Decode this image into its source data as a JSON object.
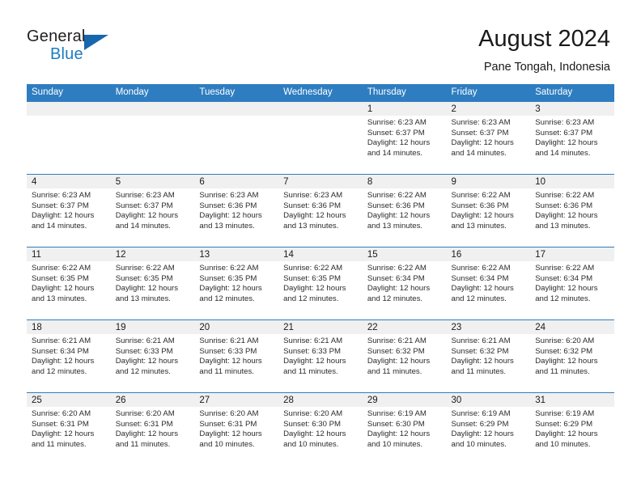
{
  "brand": {
    "word_one": "General",
    "word_two": "Blue",
    "triangle_icon": "blue-triangle-logo-mark"
  },
  "header": {
    "title": "August 2024",
    "subtitle": "Pane Tongah, Indonesia"
  },
  "colors": {
    "header_blue": "#2e7dc0",
    "brand_blue": "#1d7cc1",
    "daynum_band": "#f0f0f0",
    "text": "#1a1a1a"
  },
  "weekday_headers": [
    "Sunday",
    "Monday",
    "Tuesday",
    "Wednesday",
    "Thursday",
    "Friday",
    "Saturday"
  ],
  "labels": {
    "sunrise_prefix": "Sunrise:",
    "sunset_prefix": "Sunset:",
    "daylight_prefix": "Daylight:"
  },
  "weeks": [
    [
      {
        "day": "",
        "empty": true,
        "line1": "",
        "line2": "",
        "line3": "",
        "line4": ""
      },
      {
        "day": "",
        "empty": true,
        "line1": "",
        "line2": "",
        "line3": "",
        "line4": ""
      },
      {
        "day": "",
        "empty": true,
        "line1": "",
        "line2": "",
        "line3": "",
        "line4": ""
      },
      {
        "day": "",
        "empty": true,
        "line1": "",
        "line2": "",
        "line3": "",
        "line4": ""
      },
      {
        "day": "1",
        "line1": "Sunrise: 6:23 AM",
        "line2": "Sunset: 6:37 PM",
        "line3": "Daylight: 12 hours",
        "line4": "and 14 minutes."
      },
      {
        "day": "2",
        "line1": "Sunrise: 6:23 AM",
        "line2": "Sunset: 6:37 PM",
        "line3": "Daylight: 12 hours",
        "line4": "and 14 minutes."
      },
      {
        "day": "3",
        "line1": "Sunrise: 6:23 AM",
        "line2": "Sunset: 6:37 PM",
        "line3": "Daylight: 12 hours",
        "line4": "and 14 minutes."
      }
    ],
    [
      {
        "day": "4",
        "line1": "Sunrise: 6:23 AM",
        "line2": "Sunset: 6:37 PM",
        "line3": "Daylight: 12 hours",
        "line4": "and 14 minutes."
      },
      {
        "day": "5",
        "line1": "Sunrise: 6:23 AM",
        "line2": "Sunset: 6:37 PM",
        "line3": "Daylight: 12 hours",
        "line4": "and 14 minutes."
      },
      {
        "day": "6",
        "line1": "Sunrise: 6:23 AM",
        "line2": "Sunset: 6:36 PM",
        "line3": "Daylight: 12 hours",
        "line4": "and 13 minutes."
      },
      {
        "day": "7",
        "line1": "Sunrise: 6:23 AM",
        "line2": "Sunset: 6:36 PM",
        "line3": "Daylight: 12 hours",
        "line4": "and 13 minutes."
      },
      {
        "day": "8",
        "line1": "Sunrise: 6:22 AM",
        "line2": "Sunset: 6:36 PM",
        "line3": "Daylight: 12 hours",
        "line4": "and 13 minutes."
      },
      {
        "day": "9",
        "line1": "Sunrise: 6:22 AM",
        "line2": "Sunset: 6:36 PM",
        "line3": "Daylight: 12 hours",
        "line4": "and 13 minutes."
      },
      {
        "day": "10",
        "line1": "Sunrise: 6:22 AM",
        "line2": "Sunset: 6:36 PM",
        "line3": "Daylight: 12 hours",
        "line4": "and 13 minutes."
      }
    ],
    [
      {
        "day": "11",
        "line1": "Sunrise: 6:22 AM",
        "line2": "Sunset: 6:35 PM",
        "line3": "Daylight: 12 hours",
        "line4": "and 13 minutes."
      },
      {
        "day": "12",
        "line1": "Sunrise: 6:22 AM",
        "line2": "Sunset: 6:35 PM",
        "line3": "Daylight: 12 hours",
        "line4": "and 13 minutes."
      },
      {
        "day": "13",
        "line1": "Sunrise: 6:22 AM",
        "line2": "Sunset: 6:35 PM",
        "line3": "Daylight: 12 hours",
        "line4": "and 12 minutes."
      },
      {
        "day": "14",
        "line1": "Sunrise: 6:22 AM",
        "line2": "Sunset: 6:35 PM",
        "line3": "Daylight: 12 hours",
        "line4": "and 12 minutes."
      },
      {
        "day": "15",
        "line1": "Sunrise: 6:22 AM",
        "line2": "Sunset: 6:34 PM",
        "line3": "Daylight: 12 hours",
        "line4": "and 12 minutes."
      },
      {
        "day": "16",
        "line1": "Sunrise: 6:22 AM",
        "line2": "Sunset: 6:34 PM",
        "line3": "Daylight: 12 hours",
        "line4": "and 12 minutes."
      },
      {
        "day": "17",
        "line1": "Sunrise: 6:22 AM",
        "line2": "Sunset: 6:34 PM",
        "line3": "Daylight: 12 hours",
        "line4": "and 12 minutes."
      }
    ],
    [
      {
        "day": "18",
        "line1": "Sunrise: 6:21 AM",
        "line2": "Sunset: 6:34 PM",
        "line3": "Daylight: 12 hours",
        "line4": "and 12 minutes."
      },
      {
        "day": "19",
        "line1": "Sunrise: 6:21 AM",
        "line2": "Sunset: 6:33 PM",
        "line3": "Daylight: 12 hours",
        "line4": "and 12 minutes."
      },
      {
        "day": "20",
        "line1": "Sunrise: 6:21 AM",
        "line2": "Sunset: 6:33 PM",
        "line3": "Daylight: 12 hours",
        "line4": "and 11 minutes."
      },
      {
        "day": "21",
        "line1": "Sunrise: 6:21 AM",
        "line2": "Sunset: 6:33 PM",
        "line3": "Daylight: 12 hours",
        "line4": "and 11 minutes."
      },
      {
        "day": "22",
        "line1": "Sunrise: 6:21 AM",
        "line2": "Sunset: 6:32 PM",
        "line3": "Daylight: 12 hours",
        "line4": "and 11 minutes."
      },
      {
        "day": "23",
        "line1": "Sunrise: 6:21 AM",
        "line2": "Sunset: 6:32 PM",
        "line3": "Daylight: 12 hours",
        "line4": "and 11 minutes."
      },
      {
        "day": "24",
        "line1": "Sunrise: 6:20 AM",
        "line2": "Sunset: 6:32 PM",
        "line3": "Daylight: 12 hours",
        "line4": "and 11 minutes."
      }
    ],
    [
      {
        "day": "25",
        "line1": "Sunrise: 6:20 AM",
        "line2": "Sunset: 6:31 PM",
        "line3": "Daylight: 12 hours",
        "line4": "and 11 minutes."
      },
      {
        "day": "26",
        "line1": "Sunrise: 6:20 AM",
        "line2": "Sunset: 6:31 PM",
        "line3": "Daylight: 12 hours",
        "line4": "and 11 minutes."
      },
      {
        "day": "27",
        "line1": "Sunrise: 6:20 AM",
        "line2": "Sunset: 6:31 PM",
        "line3": "Daylight: 12 hours",
        "line4": "and 10 minutes."
      },
      {
        "day": "28",
        "line1": "Sunrise: 6:20 AM",
        "line2": "Sunset: 6:30 PM",
        "line3": "Daylight: 12 hours",
        "line4": "and 10 minutes."
      },
      {
        "day": "29",
        "line1": "Sunrise: 6:19 AM",
        "line2": "Sunset: 6:30 PM",
        "line3": "Daylight: 12 hours",
        "line4": "and 10 minutes."
      },
      {
        "day": "30",
        "line1": "Sunrise: 6:19 AM",
        "line2": "Sunset: 6:29 PM",
        "line3": "Daylight: 12 hours",
        "line4": "and 10 minutes."
      },
      {
        "day": "31",
        "line1": "Sunrise: 6:19 AM",
        "line2": "Sunset: 6:29 PM",
        "line3": "Daylight: 12 hours",
        "line4": "and 10 minutes."
      }
    ]
  ]
}
